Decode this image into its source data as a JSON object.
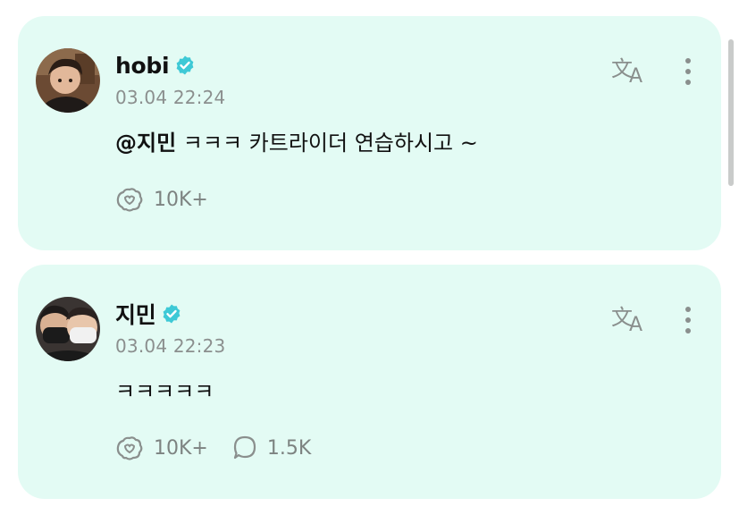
{
  "posts": [
    {
      "author": "hobi",
      "verified": true,
      "date": "03.04 22:24",
      "mention": "@지민",
      "text": " ㅋㅋㅋ 카트라이더 연습하시고 ~",
      "stats": {
        "likes": "10K+"
      }
    },
    {
      "author": "지민",
      "verified": true,
      "date": "03.04 22:23",
      "mention": "",
      "text": "ㅋㅋㅋㅋㅋ",
      "stats": {
        "likes": "10K+",
        "comments": "1.5K"
      }
    }
  ],
  "icons": {
    "verified": "verified-badge-icon",
    "translate": "translate-icon",
    "more": "more-options-icon",
    "like": "like-icon",
    "comment": "comment-icon"
  },
  "colors": {
    "card_background": "#e3fbf4",
    "verified": "#3ec9d6",
    "icon_gray": "#8a8f8d",
    "muted_text": "#8b8f8e"
  }
}
